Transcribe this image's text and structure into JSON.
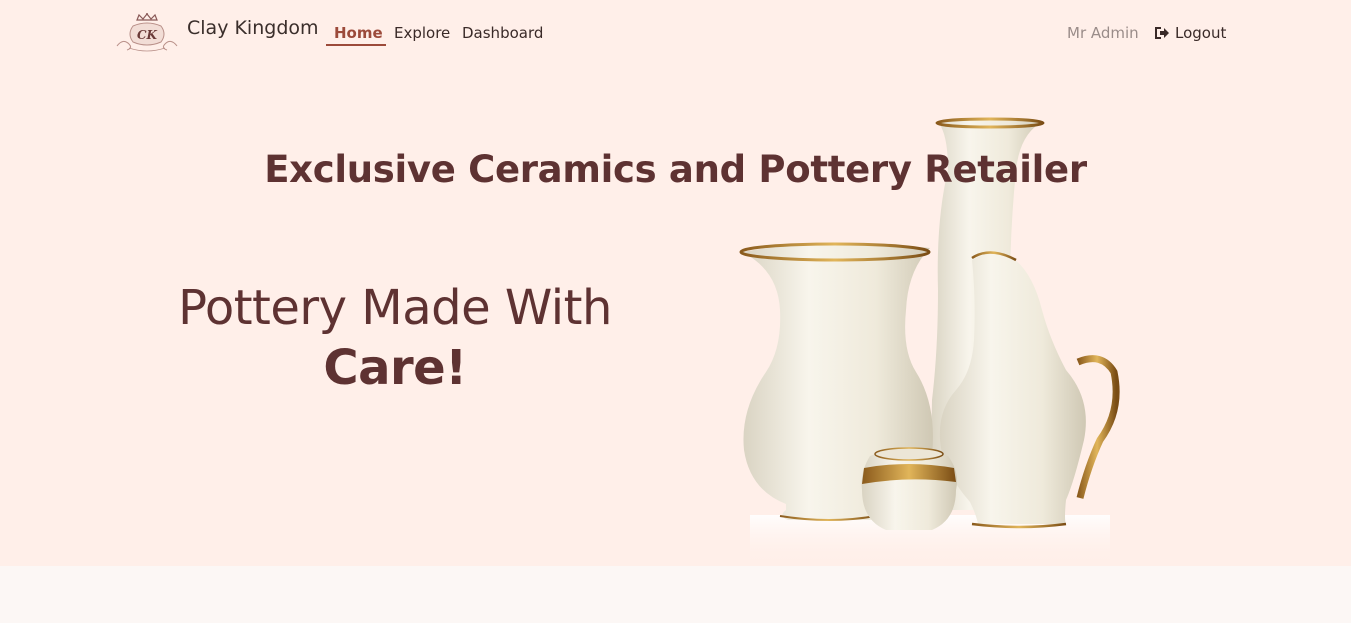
{
  "nav": {
    "brand": "Clay Kingdom",
    "links": [
      "Home",
      "Explore",
      "Dashboard"
    ],
    "active": "Home",
    "user": "Mr Admin",
    "logout": "Logout"
  },
  "hero": {
    "tagline": "Exclusive Ceramics and Pottery Retailer",
    "headline_line1": "Pottery Made With",
    "headline_line2": "Care!"
  },
  "colors": {
    "hero_bg": "#ffefe9",
    "accent": "#9c4a3a",
    "heading": "#5e3232",
    "page_bg": "#fcf7f5"
  }
}
